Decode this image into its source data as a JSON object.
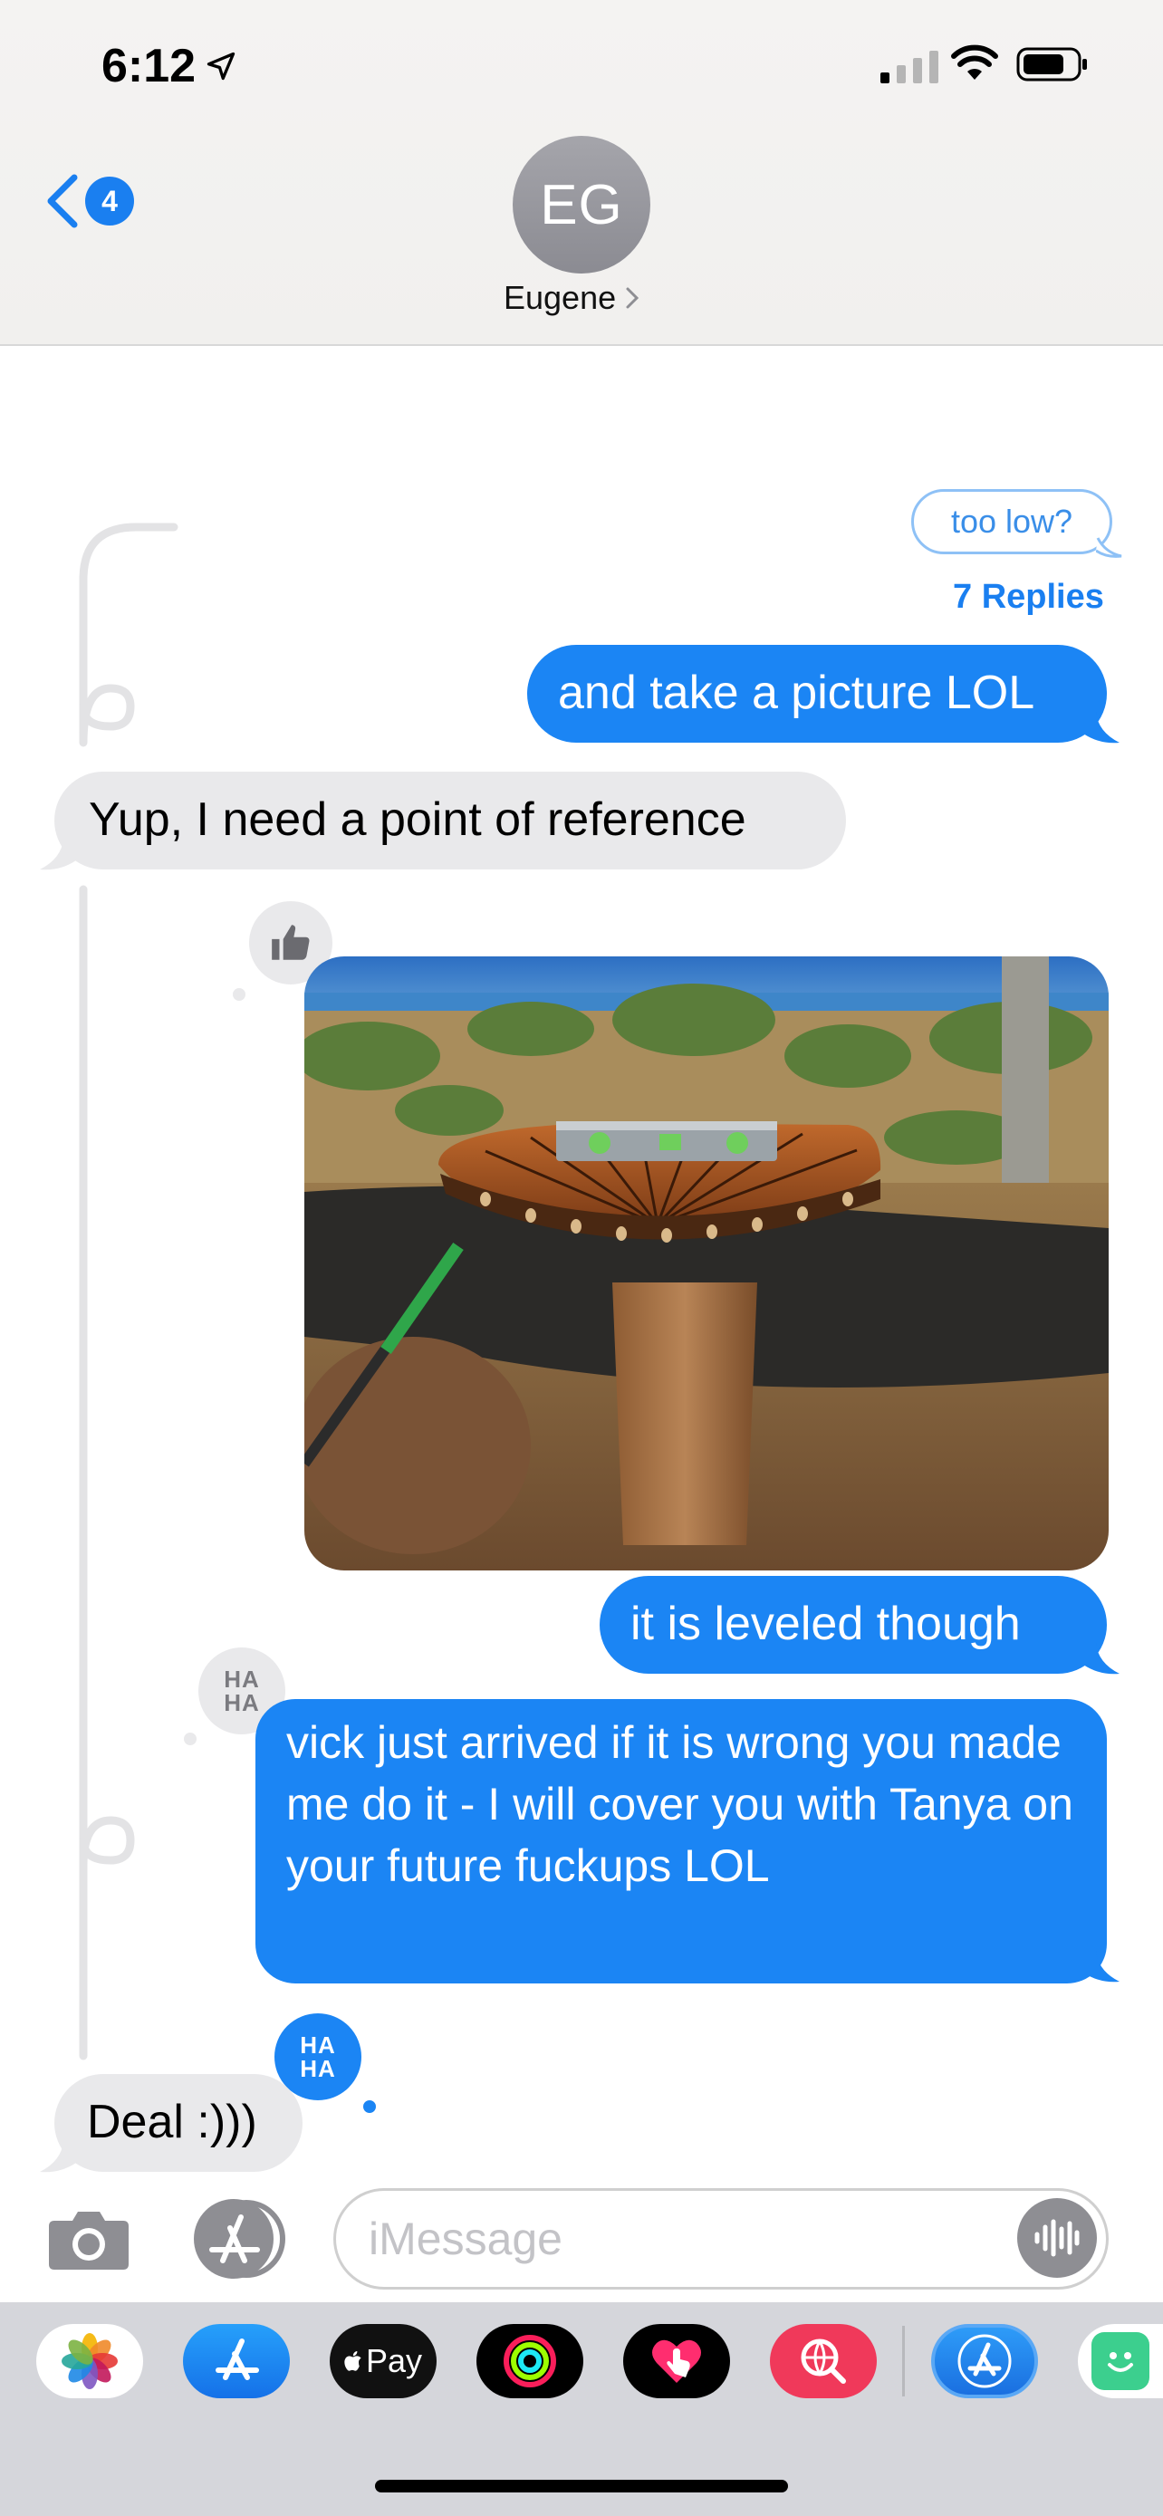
{
  "status_bar": {
    "time": "6:12",
    "icons": [
      "location-arrow-icon",
      "cellular-signal-icon",
      "wifi-icon",
      "battery-icon"
    ]
  },
  "header": {
    "back_badge": "4",
    "avatar_initials": "EG",
    "contact_name": "Eugene"
  },
  "thread": {
    "quoted_message": "too low?",
    "replies_label": "7 Replies"
  },
  "messages": [
    {
      "id": "m1",
      "sender": "me",
      "text": "and take a picture LOL"
    },
    {
      "id": "m2",
      "sender": "them",
      "text": "Yup, I need a point of reference"
    },
    {
      "id": "m3",
      "sender": "me",
      "type": "photo",
      "tapback": "thumbs-up"
    },
    {
      "id": "m4",
      "sender": "me",
      "text": "it is leveled though"
    },
    {
      "id": "m5",
      "sender": "me",
      "text": "vick just arrived if it is wrong you made me do it - I will cover you with Tanya on your future fuckups LOL",
      "tapback": "haha"
    },
    {
      "id": "m6",
      "sender": "them",
      "text": "Deal :)))",
      "tapback": "haha"
    }
  ],
  "tapbacks": {
    "haha_line1": "HA",
    "haha_line2": "HA"
  },
  "input": {
    "placeholder": "iMessage",
    "value": ""
  },
  "drawer": {
    "apps": [
      "photos",
      "app-store",
      "apple-pay",
      "activity",
      "digital-touch",
      "images-search",
      "app-store-store",
      "stickers"
    ],
    "apple_pay_label": "Pay"
  },
  "colors": {
    "accent": "#1b85f4",
    "received_bubble": "#e9e9eb",
    "thread_line": "#e3e3e5"
  }
}
